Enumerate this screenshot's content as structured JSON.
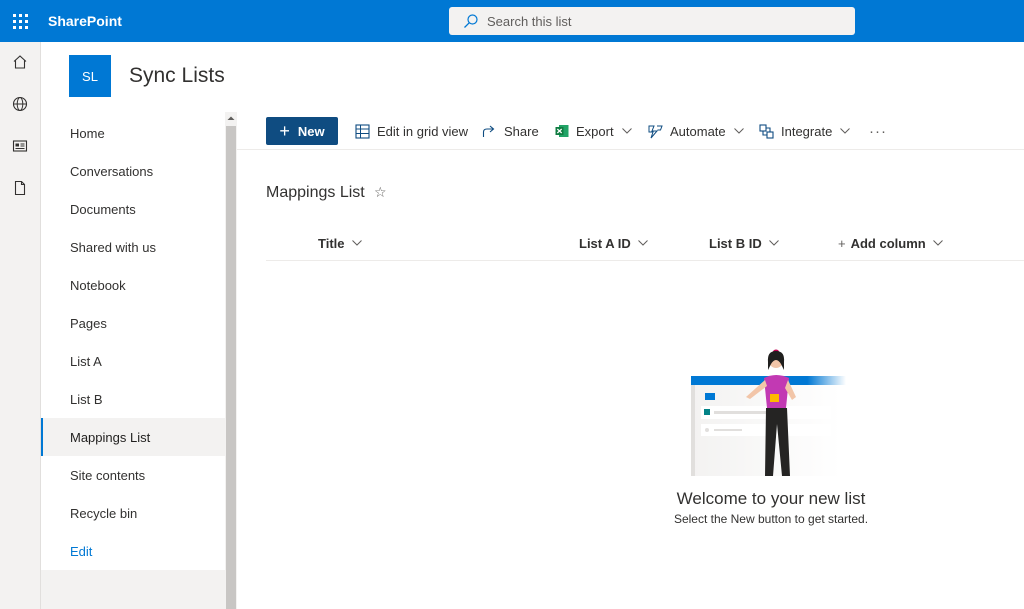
{
  "suite": {
    "brand": "SharePoint",
    "search_placeholder": "Search this list"
  },
  "appbar": {
    "items": [
      {
        "icon": "home-icon"
      },
      {
        "icon": "globe-icon"
      },
      {
        "icon": "news-icon"
      },
      {
        "icon": "document-icon"
      }
    ]
  },
  "site": {
    "logo_initials": "SL",
    "title": "Sync Lists"
  },
  "nav": {
    "items": [
      {
        "label": "Home"
      },
      {
        "label": "Conversations"
      },
      {
        "label": "Documents"
      },
      {
        "label": "Shared with us"
      },
      {
        "label": "Notebook"
      },
      {
        "label": "Pages"
      },
      {
        "label": "List A"
      },
      {
        "label": "List B"
      },
      {
        "label": "Mappings List"
      },
      {
        "label": "Site contents"
      },
      {
        "label": "Recycle bin"
      }
    ],
    "active": "Mappings List",
    "edit_label": "Edit"
  },
  "commands": {
    "new_label": "New",
    "edit_grid_label": "Edit in grid view",
    "share_label": "Share",
    "export_label": "Export",
    "automate_label": "Automate",
    "integrate_label": "Integrate",
    "more_label": "···"
  },
  "list": {
    "title": "Mappings List",
    "star": "☆",
    "columns": [
      {
        "label": "Title"
      },
      {
        "label": "List A ID"
      },
      {
        "label": "List B ID"
      },
      {
        "label": "Add column"
      }
    ],
    "add_column_prefix": "+"
  },
  "empty_state": {
    "heading": "Welcome to your new list",
    "subtext": "Select the New button to get started."
  },
  "colors": {
    "suite_bar": "#0078d4",
    "new_button": "#0f4c81",
    "active_border": "#0078d4",
    "excel_green": "#107c41"
  }
}
